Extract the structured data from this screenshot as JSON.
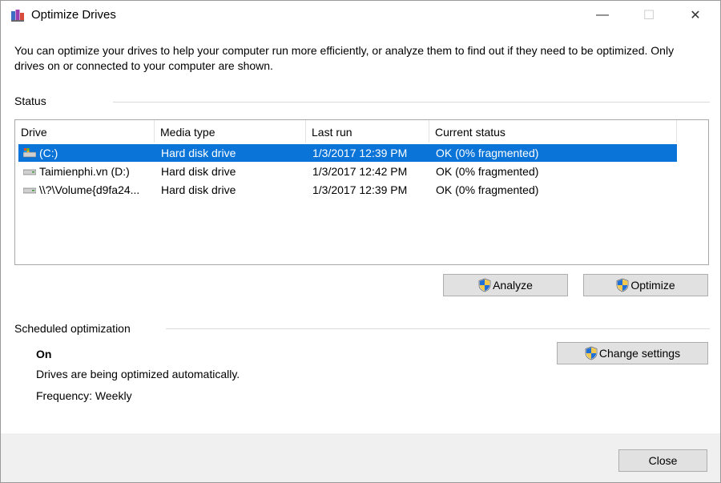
{
  "window": {
    "title": "Optimize Drives",
    "min_glyph": "—",
    "max_glyph": "☐",
    "close_glyph": "✕"
  },
  "description": "You can optimize your drives to help your computer run more efficiently, or analyze them to find out if they need to be optimized. Only drives on or connected to your computer are shown.",
  "status": {
    "title": "Status",
    "columns": [
      "Drive",
      "Media type",
      "Last run",
      "Current status"
    ],
    "rows": [
      {
        "drive": "(C:)",
        "media": "Hard disk drive",
        "last_run": "1/3/2017 12:39 PM",
        "status": "OK (0% fragmented)",
        "selected": true,
        "icon": "system-drive-icon"
      },
      {
        "drive": "Taimienphi.vn (D:)",
        "media": "Hard disk drive",
        "last_run": "1/3/2017 12:42 PM",
        "status": "OK (0% fragmented)",
        "selected": false,
        "icon": "drive-icon"
      },
      {
        "drive": "\\\\?\\Volume{d9fa24...",
        "media": "Hard disk drive",
        "last_run": "1/3/2017 12:39 PM",
        "status": "OK (0% fragmented)",
        "selected": false,
        "icon": "drive-icon"
      }
    ],
    "analyze_label": "Analyze",
    "optimize_label": "Optimize"
  },
  "scheduled": {
    "title": "Scheduled optimization",
    "state": "On",
    "description": "Drives are being optimized automatically.",
    "frequency": "Frequency: Weekly",
    "change_label": "Change settings"
  },
  "close_label": "Close",
  "colors": {
    "selection": "#0a74d8",
    "button_bg": "#e1e1e1",
    "footer_bg": "#f0f0f0"
  }
}
